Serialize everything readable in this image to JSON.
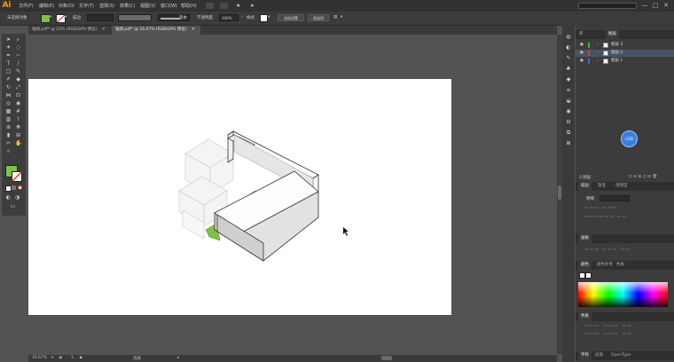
{
  "app": {
    "logo": "Ai",
    "menus": [
      "文件(F)",
      "编辑(E)",
      "对象(O)",
      "文字(T)",
      "选择(S)",
      "效果(C)",
      "视图(V)",
      "窗口(W)",
      "帮助(H)"
    ],
    "window_buttons": [
      "—",
      "□",
      "✕"
    ]
  },
  "control_bar": {
    "selection_label": "未选择对象",
    "stroke_label": "描边",
    "stroke_value": "",
    "uniform_label": "基本",
    "opacity_label": "不透明度",
    "opacity_value": "100%",
    "style_label": "样式",
    "doc_setup_button": "文档设置",
    "preferences_button": "首选项"
  },
  "tabs": [
    {
      "label": "轴测.pdf* @ 25% (RGB/GPU 预览)",
      "close": "✕"
    },
    {
      "label": "轴测.pdf* @ 16.67% (RGB/GPU 预览)",
      "close": "✕"
    }
  ],
  "status": {
    "zoom": "16.67%",
    "page": "1",
    "tool_name": "选择"
  },
  "colors": {
    "accent_green": "#7dc242",
    "fill_color": "#7dc242",
    "artboard": "#ffffff"
  },
  "layers_panel": {
    "tabs": [
      "库",
      "图层"
    ],
    "layers": [
      {
        "name": "图层 3",
        "color": "#3bb34a"
      },
      {
        "name": "图层 2",
        "color": "#d63a3a"
      },
      {
        "name": "图层 1",
        "color": "#3a6fd6"
      }
    ],
    "footer": "3 图层"
  },
  "transform_panel": {
    "tabs": [
      "描边",
      "渐变",
      "透明度"
    ],
    "weight_label": "粗细"
  },
  "appearance_panel": {
    "title": "画板"
  },
  "color_panel": {
    "tabs": [
      "颜色",
      "颜色参考",
      "色板"
    ]
  },
  "swatches_panel": {
    "title": "色板"
  },
  "char_panel": {
    "tabs": [
      "字符",
      "段落",
      "OpenType"
    ]
  }
}
